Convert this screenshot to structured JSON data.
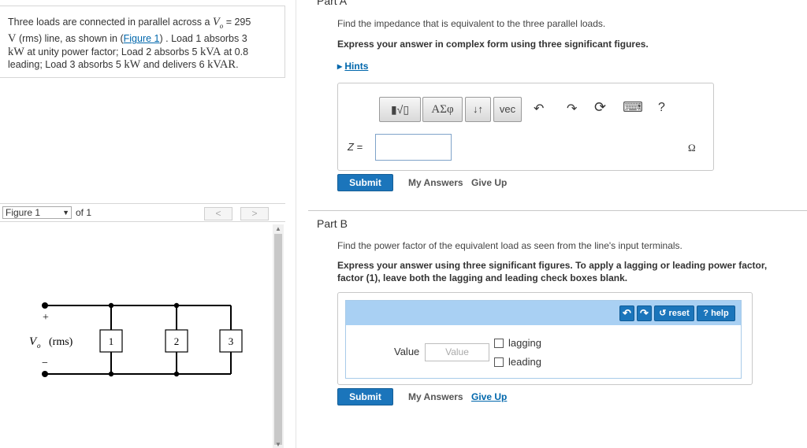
{
  "problem": {
    "t1": "Three loads are connected in parallel across a ",
    "vo_sym": "V",
    "vo_sub": "o",
    "t2": " = 295",
    "t3": "V",
    "t4": " (rms) line, as shown in (",
    "fig_link": "Figure 1",
    "t5": ") . Load 1 absorbs 3",
    "t6": "kW",
    "t7": " at unity power factor; Load 2 absorbs 5 ",
    "t8": "kVA",
    "t9": " at 0.8",
    "t10": "leading; Load 3 absorbs 5 ",
    "t11": "kW",
    "t12": " and delivers 6 ",
    "t13": "kVAR",
    "t14": "."
  },
  "figure": {
    "select_value": "Figure 1",
    "of_text": "of 1",
    "prev": "<",
    "next": ">",
    "plus": "+",
    "minus": "−",
    "source_label": "V",
    "source_sub": "o",
    "source_unit": "(rms)",
    "loads": [
      "1",
      "2",
      "3"
    ]
  },
  "partA": {
    "title": "Part A",
    "prompt": "Find the impedance that is equivalent to the three parallel loads.",
    "instruction": "Express your answer in complex form using three significant figures.",
    "hints_arrow": "▸",
    "hints": "Hints",
    "toolbar": {
      "templates": "▮√▯",
      "greek": "ΑΣφ",
      "arrows": "↓↑",
      "vec": "vec",
      "undo": "↶",
      "redo": "↷",
      "reset": "⟳",
      "keyboard": "⌨",
      "help": "?"
    },
    "z_label": "Z =",
    "unit": "Ω",
    "submit": "Submit",
    "my_answers": "My Answers",
    "give_up": "Give Up"
  },
  "partB": {
    "title": "Part B",
    "prompt": "Find the power factor of the equivalent load as seen from the line's input terminals.",
    "instruction_line1": "Express your answer using three significant figures. To apply a lagging or leading power factor,",
    "instruction_line2": "factor (1), leave both the lagging and leading check boxes blank.",
    "undo": "↶",
    "redo": "↷",
    "reset": "↺ reset",
    "help": "? help",
    "value_label": "Value",
    "value_placeholder": "Value",
    "lagging": "lagging",
    "leading": "leading",
    "submit": "Submit",
    "my_answers": "My Answers",
    "give_up": "Give Up"
  }
}
